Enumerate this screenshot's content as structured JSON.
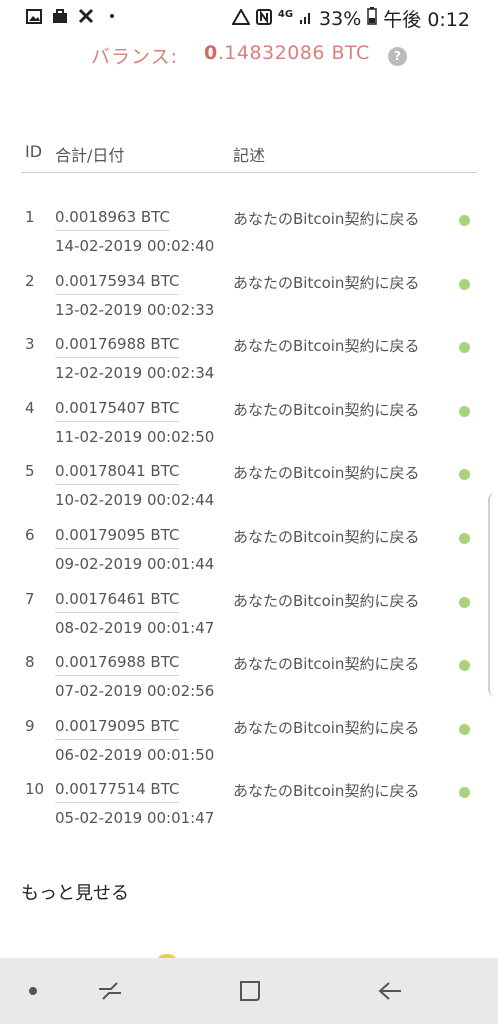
{
  "status_bar": {
    "left_icons": [
      "image-icon",
      "briefcase-icon",
      "tools-icon",
      "dot-icon"
    ],
    "right_icons": [
      "alert-icon",
      "nfc-icon",
      "signal-icon",
      "battery-icon"
    ],
    "network": "4G",
    "battery": "33%",
    "time": "午後 0:12"
  },
  "balance": {
    "label": "バランス:",
    "value_lead": "0",
    "value_rest": ".14832086 BTC",
    "help": "?",
    "color": "#d9817c"
  },
  "table": {
    "headers": {
      "id": "ID",
      "amount_date": "合計/日付",
      "description": "記述"
    },
    "rows": [
      {
        "id": "1",
        "amount": "0.0018963 BTC",
        "date": "14-02-2019 00:02:40",
        "description": "あなたのBitcoin契約に戻る"
      },
      {
        "id": "2",
        "amount": "0.00175934 BTC",
        "date": "13-02-2019 00:02:33",
        "description": "あなたのBitcoin契約に戻る"
      },
      {
        "id": "3",
        "amount": "0.00176988 BTC",
        "date": "12-02-2019 00:02:34",
        "description": "あなたのBitcoin契約に戻る"
      },
      {
        "id": "4",
        "amount": "0.00175407 BTC",
        "date": "11-02-2019 00:02:50",
        "description": "あなたのBitcoin契約に戻る"
      },
      {
        "id": "5",
        "amount": "0.00178041 BTC",
        "date": "10-02-2019 00:02:44",
        "description": "あなたのBitcoin契約に戻る"
      },
      {
        "id": "6",
        "amount": "0.00179095 BTC",
        "date": "09-02-2019 00:01:44",
        "description": "あなたのBitcoin契約に戻る"
      },
      {
        "id": "7",
        "amount": "0.00176461 BTC",
        "date": "08-02-2019 00:01:47",
        "description": "あなたのBitcoin契約に戻る"
      },
      {
        "id": "8",
        "amount": "0.00176988 BTC",
        "date": "07-02-2019 00:02:56",
        "description": "あなたのBitcoin契約に戻る"
      },
      {
        "id": "9",
        "amount": "0.00179095 BTC",
        "date": "06-02-2019 00:01:50",
        "description": "あなたのBitcoin契約に戻る"
      },
      {
        "id": "10",
        "amount": "0.00177514 BTC",
        "date": "05-02-2019 00:01:47",
        "description": "あなたのBitcoin契約に戻る"
      }
    ],
    "status_dot_color": "#a7d37a"
  },
  "more_link": "もっと見せる",
  "nav_bar": {
    "buttons": [
      "recent-apps-icon",
      "home-icon",
      "back-icon"
    ]
  }
}
